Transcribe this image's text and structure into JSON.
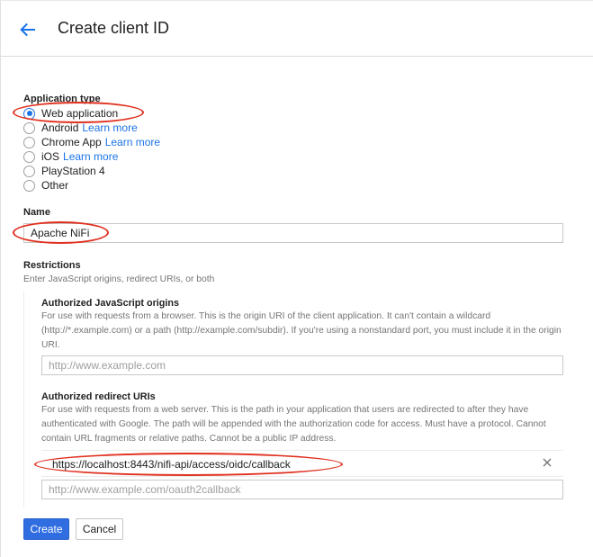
{
  "header": {
    "title": "Create client ID"
  },
  "application_type": {
    "label": "Application type",
    "options": [
      {
        "label": "Web application",
        "link": "",
        "checked": true
      },
      {
        "label": "Android",
        "link": "Learn more",
        "checked": false
      },
      {
        "label": "Chrome App",
        "link": "Learn more",
        "checked": false
      },
      {
        "label": "iOS",
        "link": "Learn more",
        "checked": false
      },
      {
        "label": "PlayStation 4",
        "link": "",
        "checked": false
      },
      {
        "label": "Other",
        "link": "",
        "checked": false
      }
    ]
  },
  "name": {
    "label": "Name",
    "value": "Apache NiFi"
  },
  "restrictions": {
    "label": "Restrictions",
    "description": "Enter JavaScript origins, redirect URIs, or both",
    "origins": {
      "label": "Authorized JavaScript origins",
      "description": "For use with requests from a browser. This is the origin URI of the client application. It can't contain a wildcard (http://*.example.com) or a path (http://example.com/subdir). If you're using a nonstandard port, you must include it in the origin URI.",
      "placeholder": "http://www.example.com"
    },
    "redirects": {
      "label": "Authorized redirect URIs",
      "description": "For use with requests from a web server. This is the path in your application that users are redirected to after they have authenticated with Google. The path will be appended with the authorization code for access. Must have a protocol. Cannot contain URL fragments or relative paths. Cannot be a public IP address.",
      "entries": [
        "https://localhost:8443/nifi-api/access/oidc/callback"
      ],
      "placeholder": "http://www.example.com/oauth2callback"
    }
  },
  "actions": {
    "create": "Create",
    "cancel": "Cancel"
  },
  "colors": {
    "accent": "#1a73e8",
    "primary_button": "#2f6de1",
    "annotation": "#e0301e"
  },
  "icons": {
    "back": "arrow-left-icon",
    "remove": "close-icon"
  }
}
